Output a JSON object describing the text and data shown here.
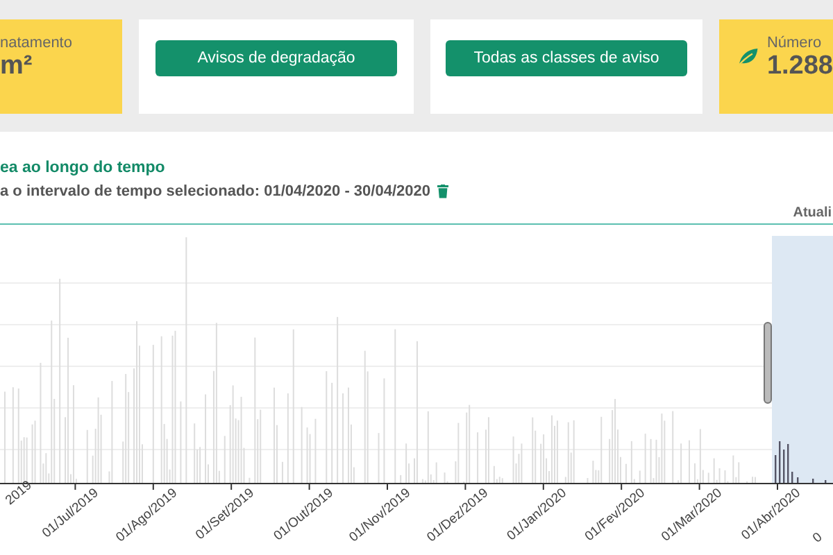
{
  "cards": [
    {
      "kind": "stat",
      "label": "natamento",
      "value": "m²",
      "has_icon": false
    },
    {
      "kind": "action",
      "button": "Avisos de degradação"
    },
    {
      "kind": "action",
      "button": "Todas as classes de aviso"
    },
    {
      "kind": "stat",
      "label": "Número",
      "value": "1.288",
      "has_icon": true
    }
  ],
  "panel": {
    "title": "ea ao longo do tempo",
    "subtitle": "a o intervalo de tempo selecionado: 01/04/2020 - 30/04/2020",
    "updated": "Atuali",
    "axis_labels": [
      "2019",
      "01/Jul/2019",
      "01/Ago/2019",
      "01/Set/2019",
      "01/Out/2019",
      "01/Nov/2019",
      "01/Dez/2019",
      "01/Jan/2020",
      "01/Fev/2020",
      "01/Mar/2020",
      "01/Abr/2020",
      "0"
    ]
  }
}
